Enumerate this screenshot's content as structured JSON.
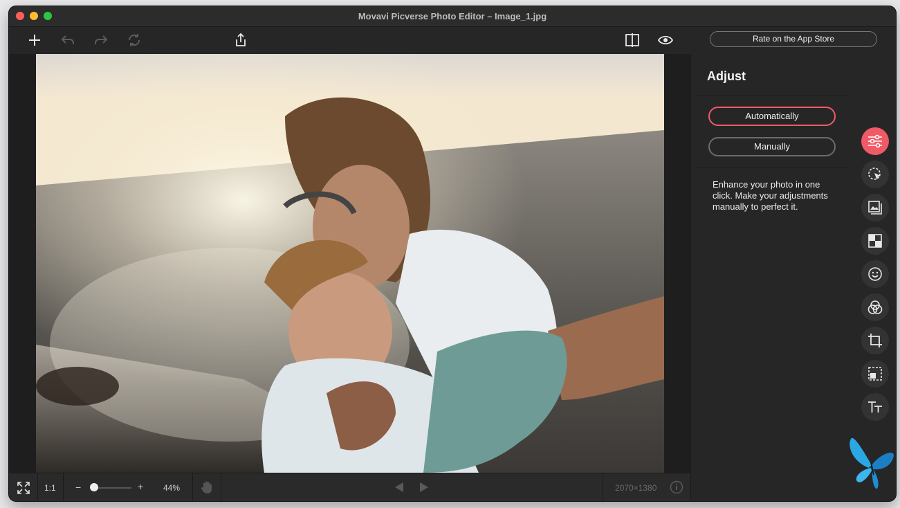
{
  "window": {
    "title": "Movavi Picverse Photo Editor – Image_1.jpg"
  },
  "toolbar": {
    "rate_label": "Rate on the App Store",
    "icons": [
      "add-icon",
      "undo-icon",
      "redo-icon",
      "rotate-icon",
      "share-icon",
      "compare-icon",
      "preview-eye-icon"
    ]
  },
  "panel": {
    "title": "Adjust",
    "auto_label": "Automatically",
    "manual_label": "Manually",
    "description": "Enhance your photo in one click. Make your adjustments manually to perfect it."
  },
  "rail": {
    "tools": [
      "adjust-sliders-icon",
      "object-removal-icon",
      "background-icon",
      "retouch-icon",
      "face-icon",
      "filters-icon",
      "crop-icon",
      "selection-icon",
      "text-icon"
    ],
    "active": "adjust-sliders-icon"
  },
  "bottombar": {
    "one_to_one": "1:1",
    "zoom_minus": "−",
    "zoom_plus": "+",
    "zoom_percent": "44%",
    "zoom_level": 0.1,
    "dimensions": "2070×1380"
  },
  "colors": {
    "accent": "#f05a66",
    "background": "#262627"
  }
}
